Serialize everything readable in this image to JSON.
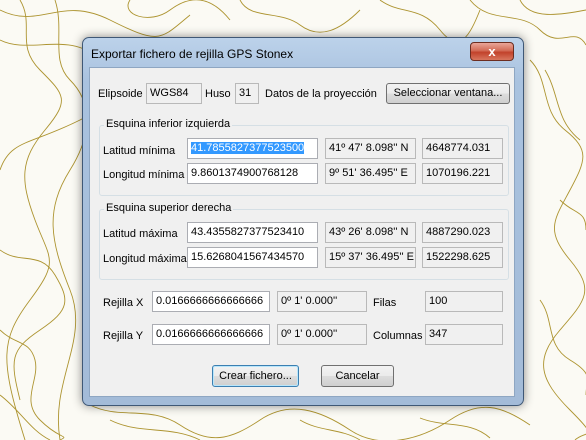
{
  "window": {
    "title": "Exportar fichero de rejilla GPS Stonex",
    "close_glyph": "x"
  },
  "header": {
    "ellipsoid_label": "Elipsoide",
    "ellipsoid_value": "WGS84",
    "zone_label": "Huso",
    "zone_value": "31",
    "projection_label": "Datos de la proyección",
    "select_window_button": "Seleccionar ventana..."
  },
  "lower_left": {
    "title": "Esquina inferior izquierda",
    "lat_label": "Latitud mínima",
    "lat_value": "41.7855827377523500",
    "lat_dms": "41º 47' 8.098'' N",
    "lat_utm": "4648774.031",
    "lon_label": "Longitud mínima",
    "lon_value": "9.8601374900768128",
    "lon_dms": "9º 51' 36.495'' E",
    "lon_utm": "1070196.221"
  },
  "upper_right": {
    "title": "Esquina superior derecha",
    "lat_label": "Latitud máxima",
    "lat_value": "43.4355827377523410",
    "lat_dms": "43º 26' 8.098'' N",
    "lat_utm": "4887290.023",
    "lon_label": "Longitud máxima",
    "lon_value": "15.6268041567434570",
    "lon_dms": "15º 37' 36.495'' E",
    "lon_utm": "1522298.625"
  },
  "grid": {
    "x_label": "Rejilla X",
    "x_value": "0.0166666666666666",
    "x_dms": "0º 1' 0.000''",
    "rows_label": "Filas",
    "rows_value": "100",
    "y_label": "Rejilla Y",
    "y_value": "0.0166666666666666",
    "y_dms": "0º 1' 0.000''",
    "cols_label": "Columnas",
    "cols_value": "347"
  },
  "buttons": {
    "create": "Crear fichero...",
    "cancel": "Cancelar"
  },
  "colors": {
    "contour": "#a98f28",
    "background": "#fbfaf4",
    "selection": "#3399ff"
  }
}
